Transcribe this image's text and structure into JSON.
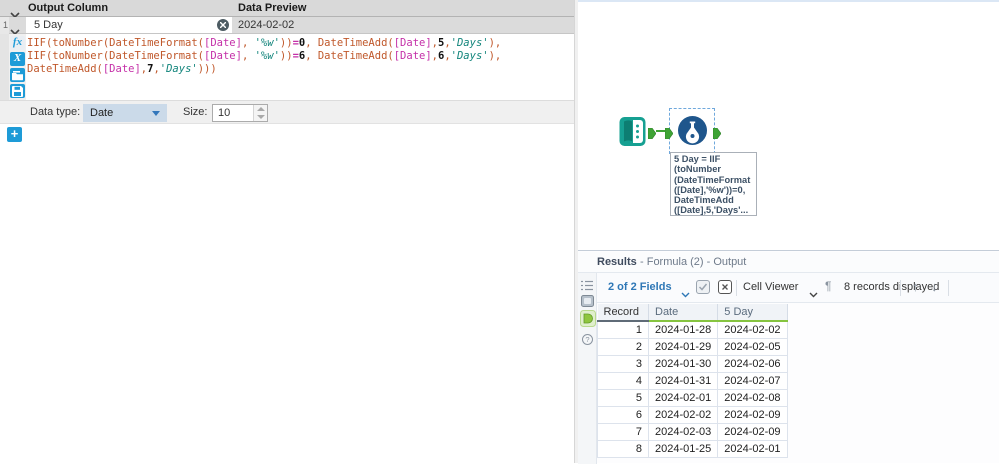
{
  "config": {
    "header": {
      "col1": "Output Column",
      "col2": "Data Preview"
    },
    "row1": {
      "index": "1",
      "name": "5 Day",
      "preview": "2024-02-02"
    },
    "editor_icons": {
      "functions_label": "fx",
      "variables_label": "X"
    },
    "formula_lines": [
      [
        [
          "f",
          "IIF(toNumber(DateTimeFormat("
        ],
        [
          "v",
          "[Date]"
        ],
        [
          "f",
          ", "
        ],
        [
          "s",
          "'%w'"
        ],
        [
          "f",
          "))"
        ],
        [
          "o",
          "="
        ],
        [
          "n",
          "0"
        ],
        [
          "f",
          ", DateTimeAdd("
        ],
        [
          "v",
          "[Date]"
        ],
        [
          "f",
          ","
        ],
        [
          "n",
          "5"
        ],
        [
          "f",
          ","
        ],
        [
          "s",
          "'Days'"
        ],
        [
          "f",
          "),"
        ]
      ],
      [
        [
          "f",
          "IIF(toNumber(DateTimeFormat("
        ],
        [
          "v",
          "[Date]"
        ],
        [
          "f",
          ", "
        ],
        [
          "s",
          "'%w'"
        ],
        [
          "f",
          "))"
        ],
        [
          "o",
          "="
        ],
        [
          "n",
          "6"
        ],
        [
          "f",
          ", DateTimeAdd("
        ],
        [
          "v",
          "[Date]"
        ],
        [
          "f",
          ","
        ],
        [
          "n",
          "6"
        ],
        [
          "f",
          ","
        ],
        [
          "s",
          "'Days'"
        ],
        [
          "f",
          "),"
        ]
      ],
      [
        [
          "f",
          "DateTimeAdd("
        ],
        [
          "v",
          "[Date]"
        ],
        [
          "f",
          ","
        ],
        [
          "n",
          "7"
        ],
        [
          "f",
          ","
        ],
        [
          "s",
          "'Days'"
        ],
        [
          "f",
          ")))"
        ]
      ]
    ],
    "datatype": {
      "label": "Data type:",
      "value": "Date",
      "size_label": "Size:",
      "size_value": "10"
    },
    "add_label": "+"
  },
  "canvas": {
    "annotation_lines": [
      "5 Day = IIF",
      "(toNumber",
      "(DateTimeFormat",
      "([Date],'%w'))=0,",
      "DateTimeAdd",
      "([Date],5,'Days'..."
    ]
  },
  "results": {
    "title": "Results",
    "title_suffix": "- Formula (2) - Output",
    "toolbar": {
      "fields_label": "2 of 2 Fields",
      "cell_viewer_label": "Cell Viewer",
      "records_label": "8 records displayed",
      "up_arrow": "↑",
      "down_arrow": "↓",
      "pilcrow": "¶"
    },
    "table": {
      "columns": [
        "Record",
        "Date",
        "5 Day"
      ],
      "rows": [
        [
          "1",
          "2024-01-28",
          "2024-02-02"
        ],
        [
          "2",
          "2024-01-29",
          "2024-02-05"
        ],
        [
          "3",
          "2024-01-30",
          "2024-02-06"
        ],
        [
          "4",
          "2024-01-31",
          "2024-02-07"
        ],
        [
          "5",
          "2024-02-01",
          "2024-02-08"
        ],
        [
          "6",
          "2024-02-02",
          "2024-02-09"
        ],
        [
          "7",
          "2024-02-03",
          "2024-02-09"
        ],
        [
          "8",
          "2024-01-25",
          "2024-02-01"
        ]
      ]
    }
  },
  "colors": {
    "accent_blue": "#1e9bd7",
    "tool_teal": "#16a092",
    "formula_tool_blue": "#1f568c",
    "anchor_green": "#3ea335",
    "highlight_green": "#86c440",
    "link_blue": "#2e77b6",
    "function_orange": "#c0582b",
    "variable_magenta": "#c42fa8",
    "string_teal": "#13857c"
  }
}
